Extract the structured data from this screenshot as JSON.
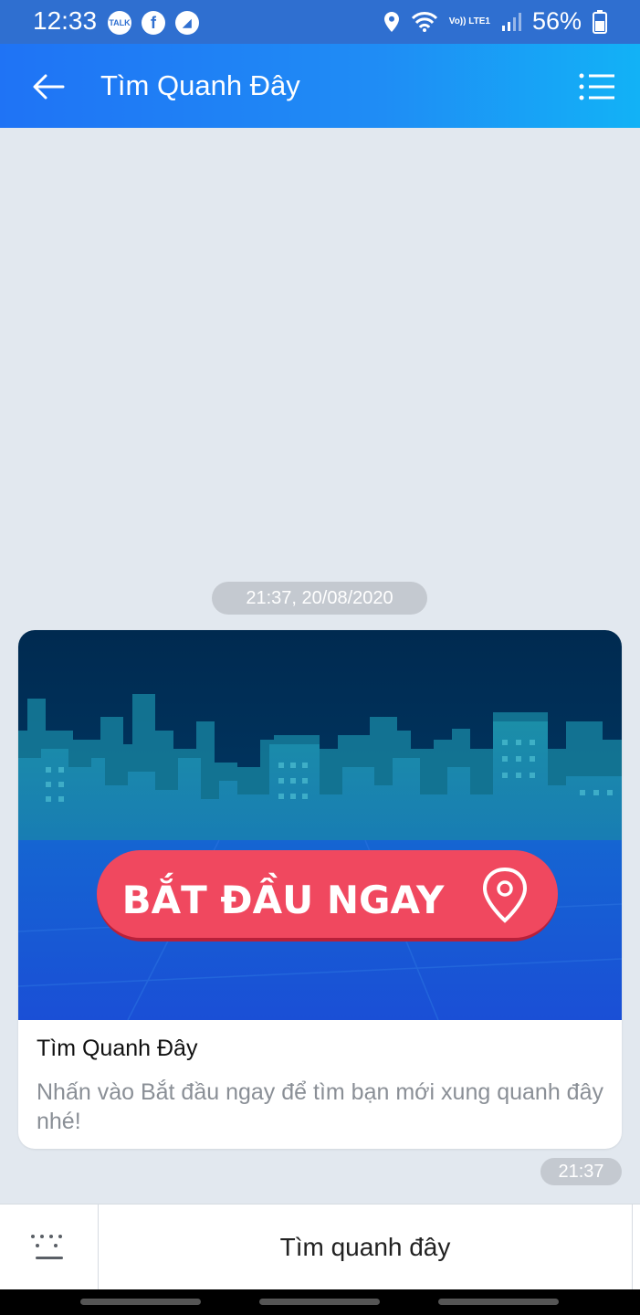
{
  "status_bar": {
    "time": "12:33",
    "app_icons": [
      "TALK",
      "f",
      "◢"
    ],
    "network": "Vo)) LTE1",
    "battery": "56%"
  },
  "header": {
    "title": "Tìm Quanh Đây"
  },
  "chat": {
    "date_stamp": "21:37, 20/08/2020",
    "card": {
      "banner_button_text": "BẮT ĐẦU NGAY",
      "title": "Tìm Quanh Đây",
      "description": "Nhấn vào Bắt đầu ngay để tìm bạn mới xung quanh đây nhé!"
    },
    "time": "21:37"
  },
  "bottom_bar": {
    "quick_action": "Tìm quanh đây"
  },
  "colors": {
    "header_start": "#1f73f5",
    "header_end": "#12b2f6",
    "banner_button": "#f0485f",
    "banner_sky": "#002a50"
  }
}
